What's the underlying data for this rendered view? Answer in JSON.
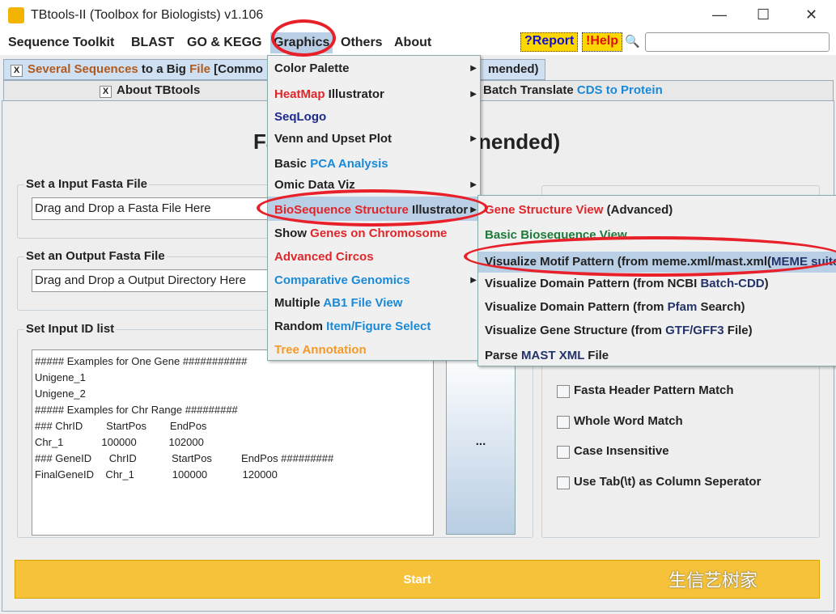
{
  "window": {
    "title": "TBtools-II (Toolbox for Biologists) v1.106",
    "minimize": "—",
    "maximize": "☐",
    "close": "✕"
  },
  "menubar": [
    "Sequence Toolkit",
    "BLAST",
    "GO & KEGG",
    "Graphics",
    "Others",
    "About"
  ],
  "report": "?Report",
  "help": "!Help",
  "search_icon": "🔍",
  "tabs": {
    "tab1_a": "Several Sequences",
    "tab1_b": " to a Big ",
    "tab1_c": "File",
    "tab1_d": " [Commo",
    "tab1_end": "mended)",
    "tab2": "About TBtools",
    "tab3_a": "Batch Translate ",
    "tab3_b": "CDS to Protein",
    "x": "X"
  },
  "page": {
    "title_left": "Fa",
    "title_right": "nended)",
    "input_label": "Set a Input Fasta File",
    "input_placeholder": "Drag and Drop a Fasta File Here",
    "output_label": "Set an Output Fasta File",
    "output_placeholder": "Drag and Drop a Output Directory Here",
    "idlist_label": "Set Input ID list",
    "idlist_text": "##### Examples for One Gene ###########\nUnigene_1\nUnigene_2\n##### Examples for Chr Range #########\n### ChrID        StartPos        EndPos\nChr_1             100000           102000\n### GeneID      ChrID            StartPos          EndPos #########\nFinalGeneID    Chr_1             100000            120000",
    "dots": "...",
    "options": [
      "Fasta Header Pattern Match",
      "Whole Word Match",
      "Case Insensitive",
      "Use Tab(\\t) as Column Seperator"
    ],
    "start": "Start",
    "watermark": "生信艺树家"
  },
  "graphics_menu": [
    {
      "parts": [
        [
          "Color Palette",
          ""
        ]
      ],
      "sub": true
    },
    {
      "parts": [
        [
          "HeatMap",
          "red"
        ],
        [
          " Illustrator",
          ""
        ]
      ],
      "sub": true
    },
    {
      "parts": [
        [
          "SeqLogo",
          "navy"
        ]
      ],
      "sub": false
    },
    {
      "parts": [
        [
          "Venn and Upset Plot",
          ""
        ]
      ],
      "sub": true
    },
    {
      "parts": [
        [
          "Basic ",
          ""
        ],
        [
          "PCA Analysis",
          "blue"
        ]
      ],
      "sub": false
    },
    {
      "parts": [
        [
          "Omic Data Viz",
          ""
        ]
      ],
      "sub": true
    },
    {
      "parts": [
        [
          "BioSequence Structure",
          "red"
        ],
        [
          " Illustrator",
          ""
        ]
      ],
      "sub": true
    },
    {
      "parts": [
        [
          "Show ",
          ""
        ],
        [
          "Genes on Chromosome",
          "red"
        ]
      ],
      "sub": false
    },
    {
      "parts": [
        [
          "Advanced Circos",
          "red"
        ]
      ],
      "sub": false
    },
    {
      "parts": [
        [
          "Comparative Genomics",
          "blue"
        ]
      ],
      "sub": true
    },
    {
      "parts": [
        [
          "Multiple ",
          ""
        ],
        [
          "AB1 File View",
          "blue"
        ]
      ],
      "sub": false
    },
    {
      "parts": [
        [
          "Random ",
          ""
        ],
        [
          "Item/Figure Select",
          "blue"
        ]
      ],
      "sub": false
    },
    {
      "parts": [
        [
          "Tree Annotation",
          "orange"
        ]
      ],
      "sub": false
    }
  ],
  "bio_submenu": [
    {
      "parts": [
        [
          "Gene Structure View",
          "red"
        ],
        [
          " (Advanced)",
          ""
        ]
      ]
    },
    {
      "parts": [
        [
          "Basic Biosequence View",
          "green"
        ]
      ]
    },
    {
      "parts": [
        [
          "Visualize Motif Pattern (from meme.xml/mast.xml(",
          ""
        ],
        [
          "MEME suite",
          "dnavy"
        ]
      ]
    },
    {
      "parts": [
        [
          "Visualize Domain Pattern (from NCBI ",
          ""
        ],
        [
          "Batch-CDD",
          "dnavy"
        ],
        [
          ")",
          ""
        ]
      ]
    },
    {
      "parts": [
        [
          "Visualize Domain Pattern (from ",
          ""
        ],
        [
          "Pfam",
          "dnavy"
        ],
        [
          " Search)",
          ""
        ]
      ]
    },
    {
      "parts": [
        [
          "Visualize Gene Structure (from ",
          ""
        ],
        [
          "GTF/GFF3",
          "dnavy"
        ],
        [
          " File)",
          ""
        ]
      ]
    },
    {
      "parts": [
        [
          "Parse ",
          ""
        ],
        [
          "MAST XML",
          "dnavy"
        ],
        [
          " File",
          ""
        ]
      ]
    }
  ]
}
